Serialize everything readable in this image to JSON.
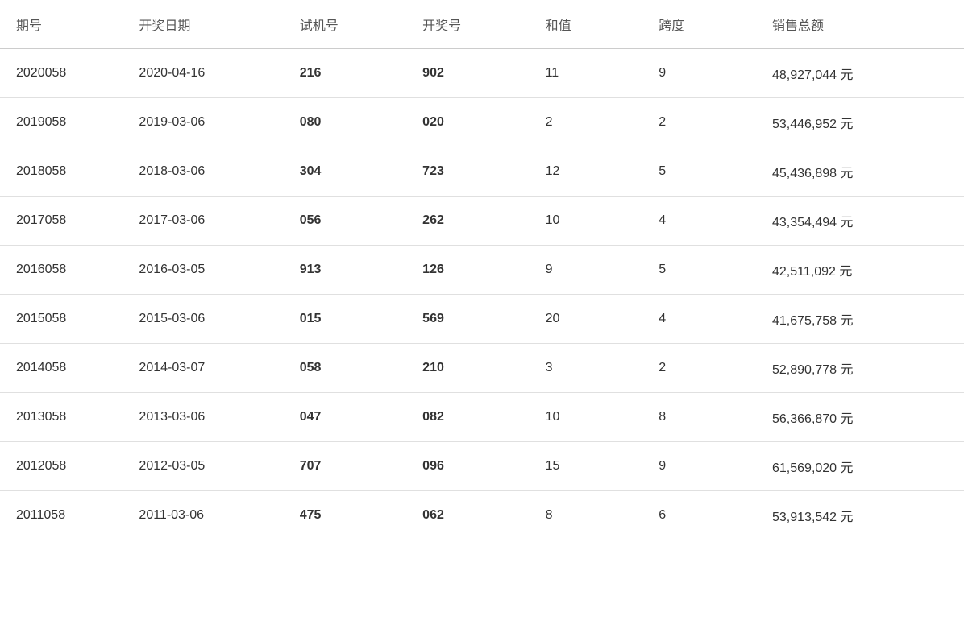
{
  "table": {
    "headers": [
      "期号",
      "开奖日期",
      "试机号",
      "开奖号",
      "和值",
      "跨度",
      "销售总额"
    ],
    "rows": [
      {
        "period": "2020058",
        "date": "2020-04-16",
        "trial": "216",
        "winning": "902",
        "sum": "11",
        "span": "9",
        "sales": "48,927,044 元"
      },
      {
        "period": "2019058",
        "date": "2019-03-06",
        "trial": "080",
        "winning": "020",
        "sum": "2",
        "span": "2",
        "sales": "53,446,952 元"
      },
      {
        "period": "2018058",
        "date": "2018-03-06",
        "trial": "304",
        "winning": "723",
        "sum": "12",
        "span": "5",
        "sales": "45,436,898 元"
      },
      {
        "period": "2017058",
        "date": "2017-03-06",
        "trial": "056",
        "winning": "262",
        "sum": "10",
        "span": "4",
        "sales": "43,354,494 元"
      },
      {
        "period": "2016058",
        "date": "2016-03-05",
        "trial": "913",
        "winning": "126",
        "sum": "9",
        "span": "5",
        "sales": "42,511,092 元"
      },
      {
        "period": "2015058",
        "date": "2015-03-06",
        "trial": "015",
        "winning": "569",
        "sum": "20",
        "span": "4",
        "sales": "41,675,758 元"
      },
      {
        "period": "2014058",
        "date": "2014-03-07",
        "trial": "058",
        "winning": "210",
        "sum": "3",
        "span": "2",
        "sales": "52,890,778 元"
      },
      {
        "period": "2013058",
        "date": "2013-03-06",
        "trial": "047",
        "winning": "082",
        "sum": "10",
        "span": "8",
        "sales": "56,366,870 元"
      },
      {
        "period": "2012058",
        "date": "2012-03-05",
        "trial": "707",
        "winning": "096",
        "sum": "15",
        "span": "9",
        "sales": "61,569,020 元"
      },
      {
        "period": "2011058",
        "date": "2011-03-06",
        "trial": "475",
        "winning": "062",
        "sum": "8",
        "span": "6",
        "sales": "53,913,542 元"
      }
    ]
  }
}
